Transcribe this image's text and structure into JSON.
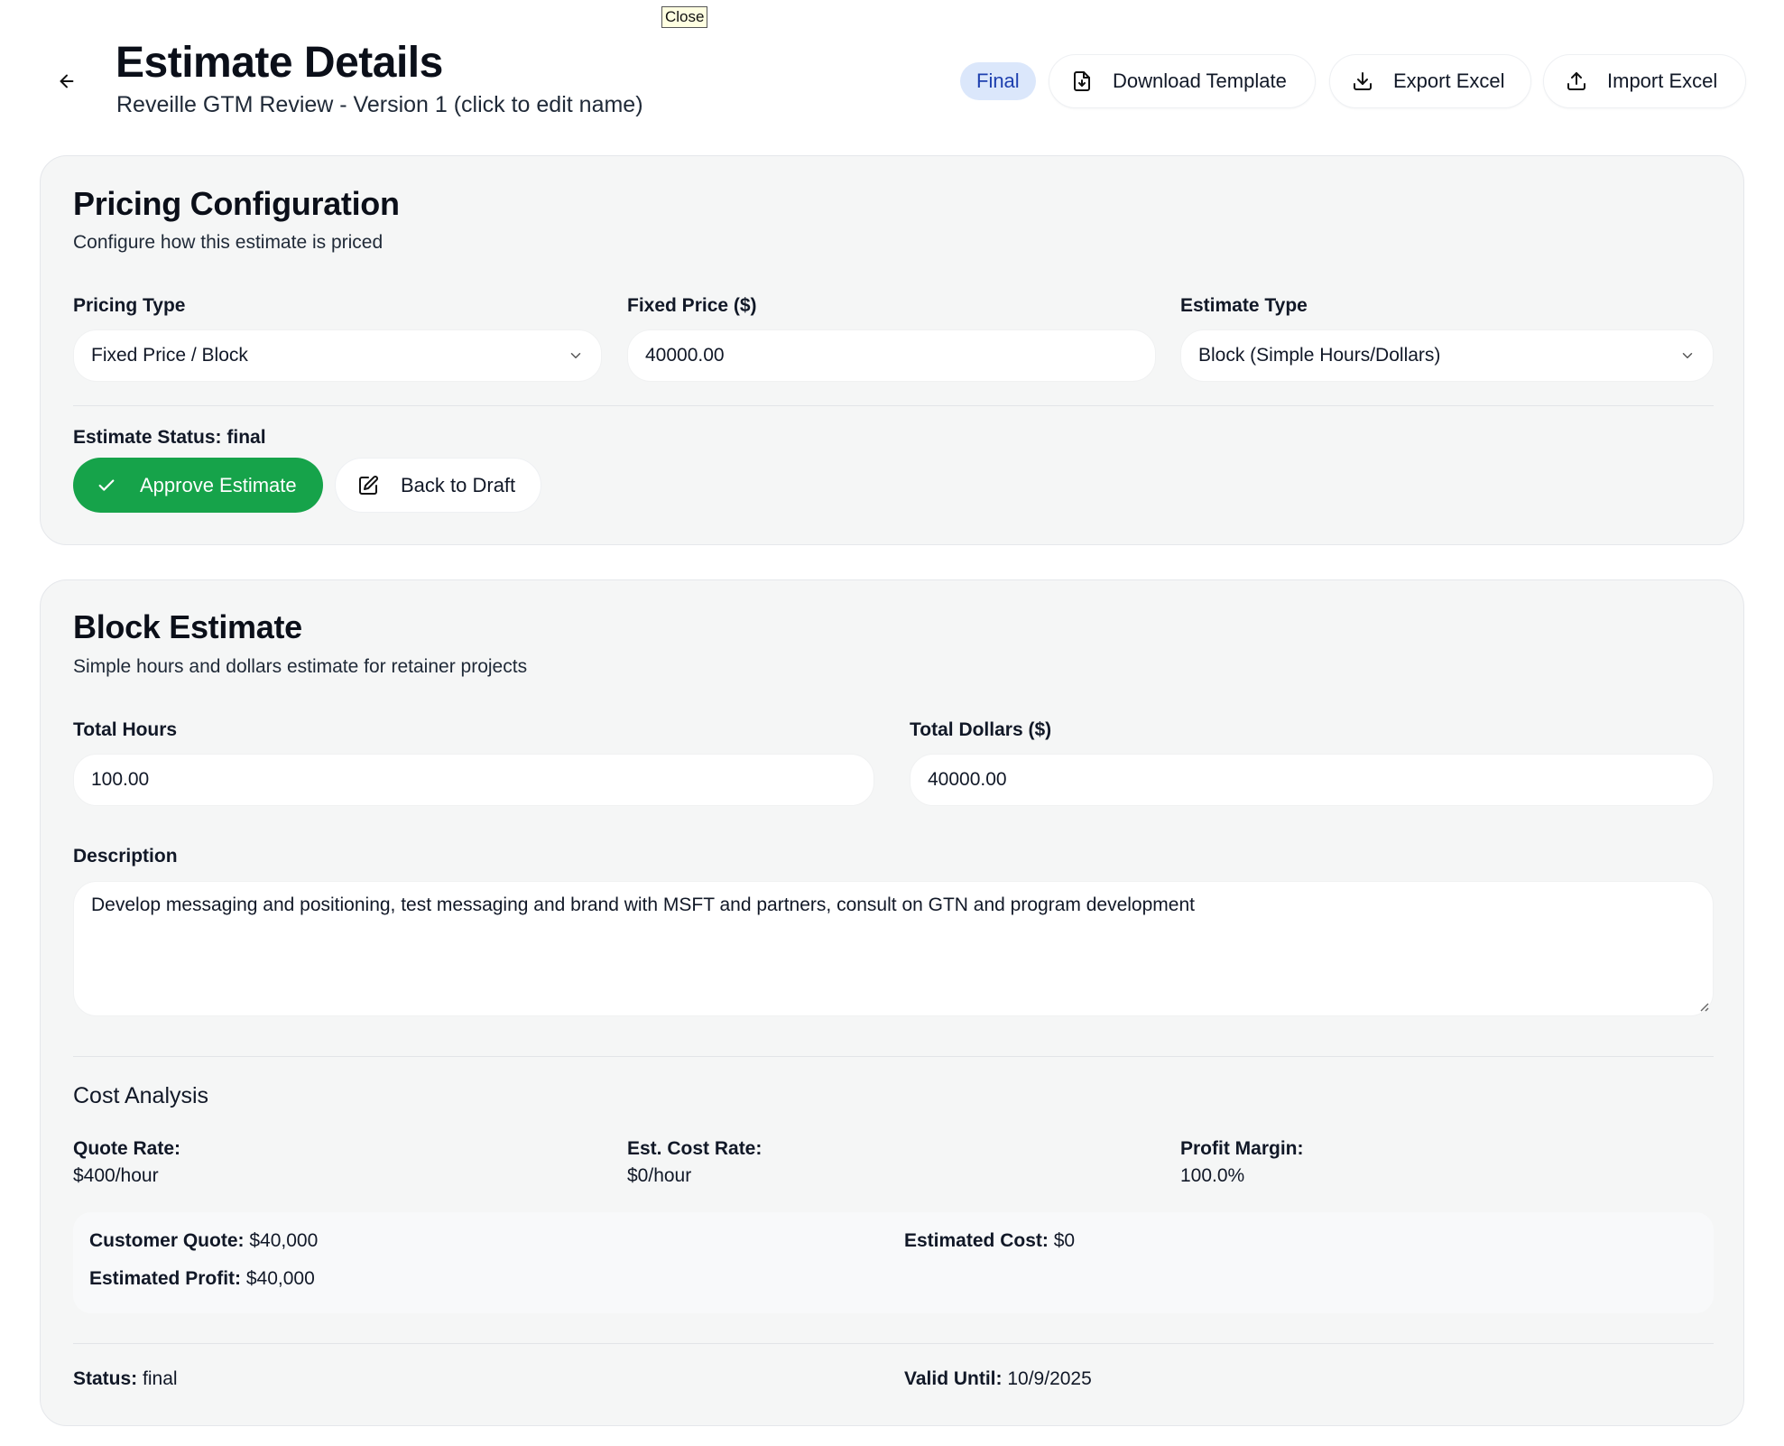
{
  "tooltip": "Close",
  "header": {
    "title": "Estimate Details",
    "subtitle": "Reveille GTM Review - Version 1 (click to edit name)",
    "badge": "Final",
    "buttons": {
      "download": "Download Template",
      "export": "Export Excel",
      "import": "Import Excel"
    }
  },
  "pricing": {
    "title": "Pricing Configuration",
    "description": "Configure how this estimate is priced",
    "pricing_type": {
      "label": "Pricing Type",
      "value": "Fixed Price / Block"
    },
    "fixed_price": {
      "label": "Fixed Price ($)",
      "value": "40000.00"
    },
    "estimate_type": {
      "label": "Estimate Type",
      "value": "Block (Simple Hours/Dollars)"
    },
    "status_label": "Estimate Status:",
    "status_value": "final",
    "approve_label": "Approve Estimate",
    "draft_label": "Back to Draft"
  },
  "block": {
    "title": "Block Estimate",
    "description": "Simple hours and dollars estimate for retainer projects",
    "total_hours": {
      "label": "Total Hours",
      "value": "100.00"
    },
    "total_dollars": {
      "label": "Total Dollars ($)",
      "value": "40000.00"
    },
    "description_field": {
      "label": "Description",
      "value": "Develop messaging and positioning, test messaging and brand with MSFT and partners, consult on GTN and program development"
    },
    "cost_analysis": {
      "title": "Cost Analysis",
      "quote_rate": {
        "label": "Quote Rate:",
        "value": "$400/hour"
      },
      "cost_rate": {
        "label": "Est. Cost Rate:",
        "value": "$0/hour"
      },
      "profit_margin": {
        "label": "Profit Margin:",
        "value": "100.0%"
      },
      "customer_quote": {
        "label": "Customer Quote:",
        "value": "$40,000"
      },
      "estimated_cost": {
        "label": "Estimated Cost:",
        "value": "$0"
      },
      "estimated_profit": {
        "label": "Estimated Profit:",
        "value": "$40,000"
      }
    },
    "footer": {
      "status": {
        "label": "Status:",
        "value": "final"
      },
      "valid_until": {
        "label": "Valid Until:",
        "value": "10/9/2025"
      }
    }
  },
  "colors": {
    "approve": "#16a34a",
    "badge_bg": "#dbe7fb",
    "badge_text": "#1e40af",
    "card_bg": "#f5f6f6"
  },
  "icons": [
    "arrow-left-icon",
    "file-download-icon",
    "download-icon",
    "upload-icon",
    "chevron-down-icon",
    "check-icon",
    "edit-icon",
    "resize-handle-icon"
  ]
}
